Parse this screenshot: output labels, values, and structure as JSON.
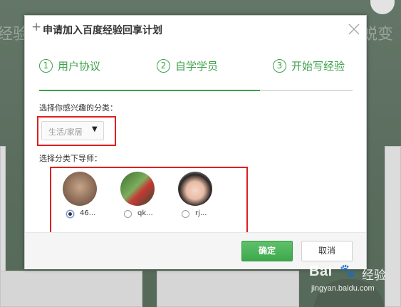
{
  "background": {
    "text_left": "经验",
    "text_right": "蜕变"
  },
  "dialog": {
    "title": "申请加入百度经验回享计划",
    "steps": [
      {
        "num": "1",
        "label": "用户协议"
      },
      {
        "num": "2",
        "label": "自学学员"
      },
      {
        "num": "3",
        "label": "开始写经验"
      }
    ],
    "category": {
      "label": "选择你感兴趣的分类：",
      "selected": "生活/家居"
    },
    "mentor": {
      "label": "选择分类下导师：",
      "items": [
        {
          "name": "46...",
          "checked": true
        },
        {
          "name": "qk...",
          "checked": false
        },
        {
          "name": "rj...",
          "checked": false
        }
      ]
    },
    "buttons": {
      "ok": "确定",
      "cancel": "取消"
    }
  },
  "watermark": {
    "logo": "Bai",
    "paw": "🐾",
    "cn": "经验",
    "url": "jingyan.baidu.com"
  },
  "colors": {
    "accent": "#3da14a",
    "highlight_border": "#e01e1e"
  }
}
